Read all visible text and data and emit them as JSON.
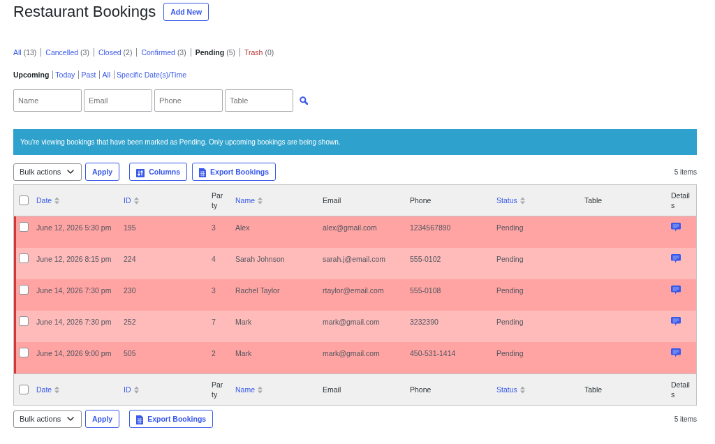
{
  "page": {
    "title": "Restaurant Bookings",
    "add_new_button": "Add New"
  },
  "status_filters": [
    {
      "label": "All",
      "count": "(13)",
      "selected": false,
      "kind": "status"
    },
    {
      "label": "Cancelled",
      "count": "(3)",
      "selected": false,
      "kind": "status"
    },
    {
      "label": "Closed",
      "count": "(2)",
      "selected": false,
      "kind": "status"
    },
    {
      "label": "Confirmed",
      "count": "(3)",
      "selected": false,
      "kind": "status"
    },
    {
      "label": "Pending",
      "count": "(5)",
      "selected": true,
      "kind": "status"
    },
    {
      "label": "Trash",
      "count": "(0)",
      "selected": false,
      "kind": "trash"
    }
  ],
  "date_filters": [
    {
      "label": "Upcoming",
      "selected": true
    },
    {
      "label": "Today",
      "selected": false
    },
    {
      "label": "Past",
      "selected": false
    },
    {
      "label": "All",
      "selected": false
    },
    {
      "label": "Specific Date(s)/Time",
      "selected": false
    }
  ],
  "search_fields": [
    {
      "placeholder": "Name"
    },
    {
      "placeholder": "Email"
    },
    {
      "placeholder": "Phone"
    },
    {
      "placeholder": "Table"
    }
  ],
  "notice": "You're viewing bookings that have been marked as Pending. Only upcoming bookings are being shown.",
  "top_toolbar": {
    "bulk_actions": "Bulk actions",
    "apply_button": "Apply",
    "buttons": [
      {
        "label": "Columns",
        "kind": "columns"
      },
      {
        "label": "Export Bookings",
        "kind": "export"
      }
    ],
    "item_count": "5 items"
  },
  "table": {
    "header": {
      "checked": false,
      "columns": [
        {
          "label": "Date",
          "sortable": true
        },
        {
          "label": "ID",
          "sortable": true
        },
        {
          "label": "Party",
          "sortable": false
        },
        {
          "label": "Name",
          "sortable": true
        },
        {
          "label": "Email",
          "sortable": false
        },
        {
          "label": "Phone",
          "sortable": false
        },
        {
          "label": "Status",
          "sortable": true
        },
        {
          "label": "Table",
          "sortable": false
        },
        {
          "label": "Details",
          "sortable": false
        }
      ]
    },
    "rows": [
      {
        "checked": false,
        "date": "June 12, 2026 5:30 pm",
        "id": "195",
        "party": "3",
        "name": "Alex",
        "email": "alex@gmail.com",
        "phone": "1234567890",
        "status": "Pending"
      },
      {
        "checked": false,
        "date": "June 12, 2026 8:15 pm",
        "id": "224",
        "party": "4",
        "name": "Sarah Johnson",
        "email": "sarah.j@email.com",
        "phone": "555-0102",
        "status": "Pending"
      },
      {
        "checked": false,
        "date": "June 14, 2026 7:30 pm",
        "id": "230",
        "party": "3",
        "name": "Rachel Taylor",
        "email": "rtaylor@email.com",
        "phone": "555-0108",
        "status": "Pending"
      },
      {
        "checked": false,
        "date": "June 14, 2026 7:30 pm",
        "id": "252",
        "party": "7",
        "name": "Mark",
        "email": "mark@gmail.com",
        "phone": "3232390",
        "status": "Pending"
      },
      {
        "checked": false,
        "date": "June 14, 2026 9:00 pm",
        "id": "505",
        "party": "2",
        "name": "Mark",
        "email": "mark@gmail.com",
        "phone": "450-531-1414",
        "status": "Pending"
      }
    ],
    "footer": {
      "checked": false,
      "columns": [
        {
          "label": "Date",
          "sortable": true
        },
        {
          "label": "ID",
          "sortable": true
        },
        {
          "label": "Party",
          "sortable": false
        },
        {
          "label": "Name",
          "sortable": true
        },
        {
          "label": "Email",
          "sortable": false
        },
        {
          "label": "Phone",
          "sortable": false
        },
        {
          "label": "Status",
          "sortable": true
        },
        {
          "label": "Table",
          "sortable": false
        },
        {
          "label": "Details",
          "sortable": false
        }
      ]
    }
  },
  "bottom_toolbar": {
    "bulk_actions": "Bulk actions",
    "apply_button": "Apply",
    "buttons": [
      {
        "label": "Export Bookings",
        "kind": "export"
      }
    ],
    "item_count": "5 items"
  }
}
